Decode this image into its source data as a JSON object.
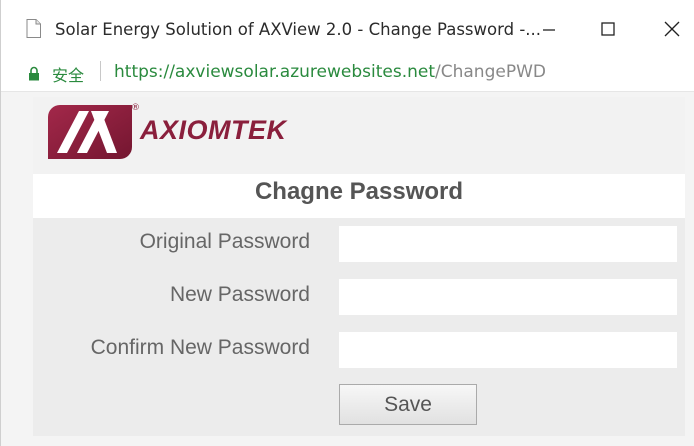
{
  "window": {
    "title": "Solar Energy Solution of AXView 2.0 - Change Password -...",
    "minimize_icon": "minimize-icon",
    "maximize_icon": "maximize-icon",
    "close_icon": "close-icon"
  },
  "address_bar": {
    "secure_label": "安全",
    "url_host": "https://axviewsolar.azurewebsites.net",
    "url_path": "/ChangePWD",
    "lock_color": "#2a8a3e"
  },
  "logo": {
    "brand": "AXIOMTEK",
    "registered": "®",
    "brand_color": "#8a1f3c"
  },
  "page": {
    "heading": "Chagne Password"
  },
  "form": {
    "original_password_label": "Original Password",
    "original_password_value": "",
    "new_password_label": "New Password",
    "new_password_value": "",
    "confirm_password_label": "Confirm New Password",
    "confirm_password_value": "",
    "save_label": "Save"
  }
}
